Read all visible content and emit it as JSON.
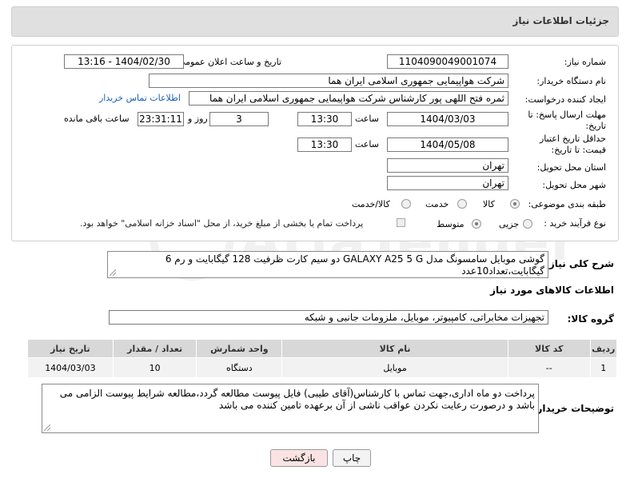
{
  "header": {
    "title": "جزئیات اطلاعات نیاز"
  },
  "fields": {
    "need_number_label": "شماره نیاز:",
    "need_number": "1104090049001074",
    "announce_label": "تاریخ و ساعت اعلان عمومی:",
    "announce_value": "1404/02/30 - 13:16",
    "buyer_org_label": "نام دستگاه خریدار:",
    "buyer_org": "شرکت هواپیمایی جمهوری اسلامی ایران هما",
    "requester_label": "ایجاد کننده درخواست:",
    "requester": "ثمره فتح اللهی پور کارشناس شرکت هواپیمایی جمهوری اسلامی ایران هما",
    "contact_link": "اطلاعات تماس خریدار",
    "deadline_label": "مهلت ارسال پاسخ: تا تاریخ:",
    "deadline_date": "1404/03/03",
    "time_label": "ساعت",
    "deadline_time": "13:30",
    "days_value": "3",
    "days_label": "روز و",
    "remaining_value": "23:31:11",
    "remaining_label": "ساعت باقی مانده",
    "validity_label": "حداقل تاریخ اعتبار قیمت: تا تاریخ:",
    "validity_date": "1404/05/08",
    "validity_time": "13:30",
    "province_label": "استان محل تحویل:",
    "province": "تهران",
    "city_label": "شهر محل تحویل:",
    "city": "تهران",
    "category_label": "طبقه بندی موضوعی:",
    "category_options": [
      "کالا",
      "خدمت",
      "کالا/خدمت"
    ],
    "process_label": "نوع فرآیند خرید :",
    "process_options": [
      "جزیی",
      "متوسط"
    ],
    "payment_note": "پرداخت تمام یا بخشی از مبلغ خرید، از محل \"اسناد خزانه اسلامی\" خواهد بود."
  },
  "description": {
    "label": "شرح کلی نیاز:",
    "text": "گوشی موبایل سامسونگ مدل GALAXY A25 5 G  دو سیم کارت ظرفیت 128 گیگابایت و رم 6 گیگابایت،تعداد10عدد"
  },
  "goods": {
    "section_title": "اطلاعات کالاهای مورد نیاز",
    "group_label": "گروه کالا:",
    "group_value": "تجهیزات مخابراتی، کامپیوتر، موبایل، ملزومات جانبی و شبکه",
    "columns": [
      "ردیف",
      "کد کالا",
      "نام کالا",
      "واحد شمارش",
      "تعداد / مقدار",
      "تاریخ نیاز"
    ],
    "rows": [
      {
        "row": "1",
        "code": "--",
        "name": "موبایل",
        "unit": "دستگاه",
        "qty": "10",
        "date": "1404/03/03"
      }
    ]
  },
  "buyer_notes": {
    "label": "توضیحات خریدار:",
    "text": "پرداخت دو ماه اداری،جهت تماس با کارشناس(آقای طیبی) فایل پیوست مطالعه گردد،مطالعه شرایط پیوست الزامی می باشد و درصورت رعایت نکردن عواقب ناشی از آن برعهده تامین کننده می باشد"
  },
  "buttons": {
    "print": "چاپ",
    "back": "بازگشت"
  },
  "colors": {
    "link": "#1a5fb4",
    "back_button_bg": "#fbe3e3"
  }
}
